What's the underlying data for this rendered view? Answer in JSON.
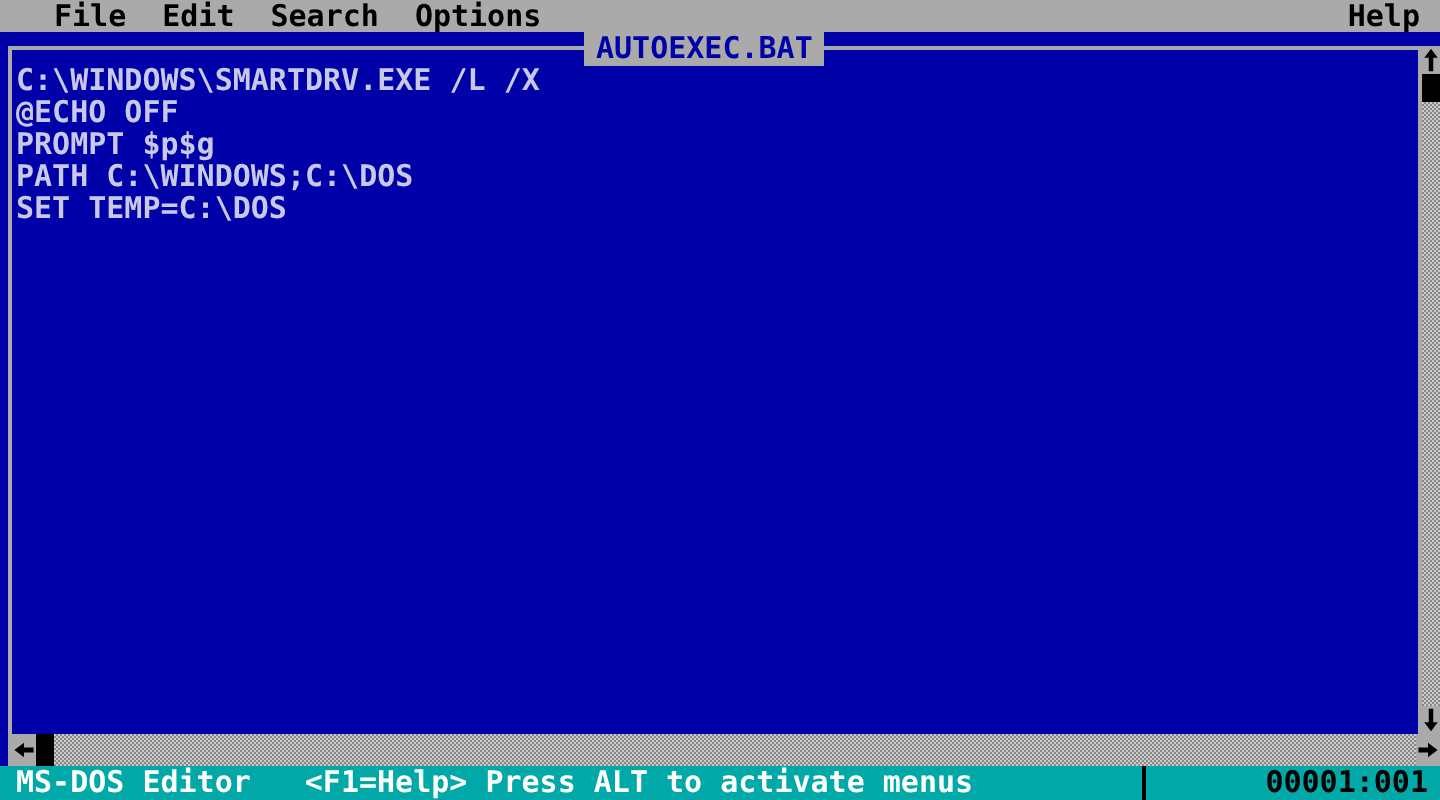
{
  "menu_bar": {
    "items": [
      {
        "label": "File"
      },
      {
        "label": "Edit"
      },
      {
        "label": "Search"
      },
      {
        "label": "Options"
      }
    ],
    "help": "Help"
  },
  "editor": {
    "title": "AUTOEXEC.BAT",
    "lines": [
      "C:\\WINDOWS\\SMARTDRV.EXE /L /X",
      "@ECHO OFF",
      "PROMPT $p$g",
      "PATH C:\\WINDOWS;C:\\DOS",
      "SET TEMP=C:\\DOS"
    ]
  },
  "status_bar": {
    "app": "MS-DOS Editor",
    "hint": "<F1=Help> Press ALT to activate menus",
    "position": "00001:001"
  }
}
